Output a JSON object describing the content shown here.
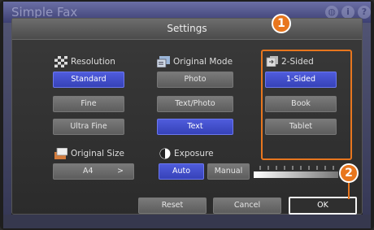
{
  "app": {
    "title": "Simple Fax"
  },
  "dialog": {
    "title": "Settings"
  },
  "resolution": {
    "label": "Resolution",
    "options": [
      "Standard",
      "Fine",
      "Ultra Fine"
    ],
    "selected": "Standard"
  },
  "original_mode": {
    "label": "Original Mode",
    "options": [
      "Photo",
      "Text/Photo",
      "Text"
    ],
    "selected": "Text"
  },
  "two_sided": {
    "label": "2-Sided",
    "options": [
      "1-Sided",
      "Book",
      "Tablet"
    ],
    "selected": "1-Sided"
  },
  "original_size": {
    "label": "Original Size",
    "value": "A4",
    "arrow": ">"
  },
  "exposure": {
    "label": "Exposure",
    "auto_label": "Auto",
    "manual_label": "Manual",
    "selected": "Auto"
  },
  "actions": {
    "reset": "Reset",
    "cancel": "Cancel",
    "ok": "OK"
  },
  "callouts": {
    "one": "1",
    "two": "2"
  },
  "top_icons": [
    "globe-icon",
    "info-icon",
    "help-icon"
  ],
  "colors": {
    "selected": "#3f4bd0",
    "highlight": "#e8761e",
    "ok_border": "#f4f4f4"
  }
}
